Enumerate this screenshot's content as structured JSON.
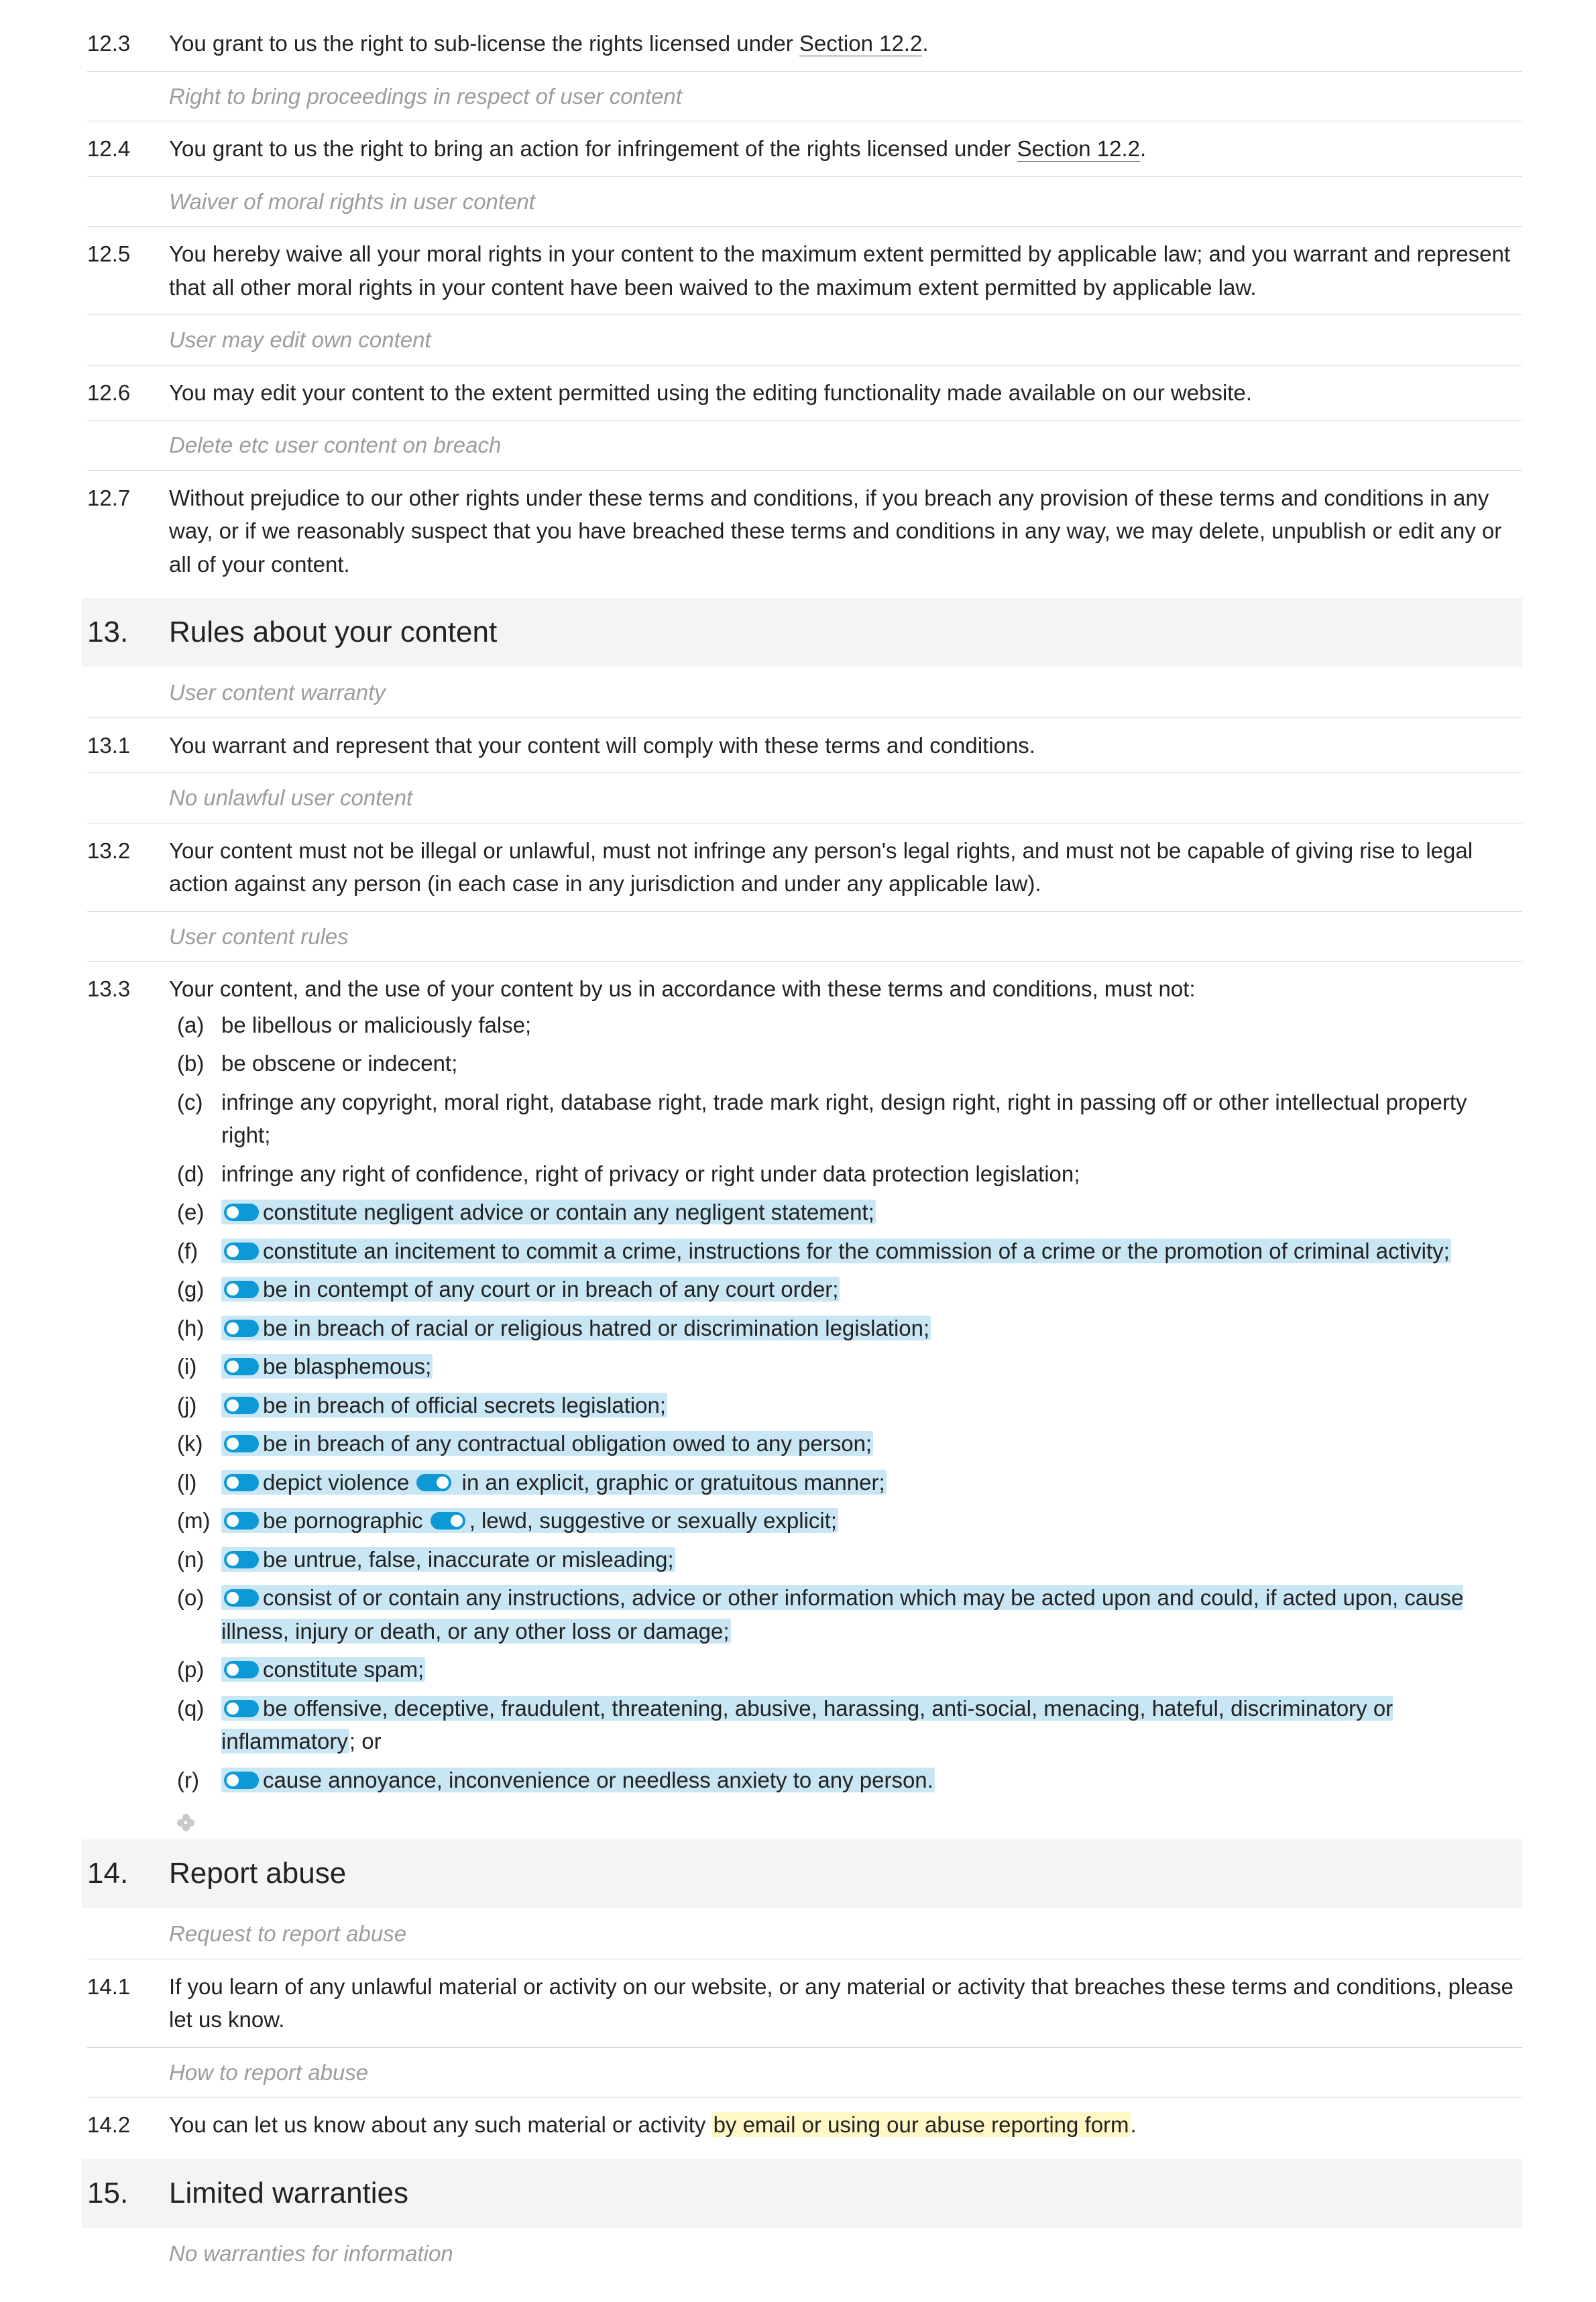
{
  "clauses": {
    "c12_3": {
      "num": "12.3",
      "text_a": "You grant to us the right to sub-license the rights licensed under ",
      "link": "Section 12.2",
      "text_b": "."
    },
    "note_12_3": "Right to bring proceedings in respect of user content",
    "c12_4": {
      "num": "12.4",
      "text_a": "You grant to us the right to bring an action for infringement of the rights licensed under ",
      "link": "Section 12.2",
      "text_b": "."
    },
    "note_12_4": "Waiver of moral rights in user content",
    "c12_5": {
      "num": "12.5",
      "text": "You hereby waive all your moral rights in your content to the maximum extent permitted by applicable law; and you warrant and represent that all other moral rights in your content have been waived to the maximum extent permitted by applicable law."
    },
    "note_12_5": "User may edit own content",
    "c12_6": {
      "num": "12.6",
      "text": "You may edit your content to the extent permitted using the editing functionality made available on our website."
    },
    "note_12_6": "Delete etc user content on breach",
    "c12_7": {
      "num": "12.7",
      "text": "Without prejudice to our other rights under these terms and conditions, if you breach any provision of these terms and conditions in any way, or if we reasonably suspect that you have breached these terms and conditions in any way, we may delete, unpublish or edit any or all of your content."
    }
  },
  "section13": {
    "num": "13.",
    "title": "Rules about your content"
  },
  "s13": {
    "note1": "User content warranty",
    "c13_1": {
      "num": "13.1",
      "text": "You warrant and represent that your content will comply with these terms and conditions."
    },
    "note2": "No unlawful user content",
    "c13_2": {
      "num": "13.2",
      "text": "Your content must not be illegal or unlawful, must not infringe any person's legal rights, and must not be capable of giving rise to legal action against any person (in each case in any jurisdiction and under any applicable law)."
    },
    "note3": "User content rules",
    "c13_3": {
      "num": "13.3",
      "intro": "Your content, and the use of your content by us in accordance with these terms and conditions, must not:",
      "items": {
        "a": {
          "mark": "(a)",
          "text": "be libellous or maliciously false;"
        },
        "b": {
          "mark": "(b)",
          "text": "be obscene or indecent;"
        },
        "c": {
          "mark": "(c)",
          "text": "infringe any copyright, moral right, database right, trade mark right, design right, right in passing off or other intellectual property right;"
        },
        "d": {
          "mark": "(d)",
          "text": "infringe any right of confidence, right of privacy or right under data protection legislation;"
        },
        "e": {
          "mark": "(e)",
          "text": "constitute negligent advice or contain any negligent statement;"
        },
        "f": {
          "mark": "(f)",
          "text": "constitute an incitement to commit a crime, instructions for the commission of a crime or the promotion of criminal activity;"
        },
        "g": {
          "mark": "(g)",
          "text": "be in contempt of any court or in breach of any court order;"
        },
        "h": {
          "mark": "(h)",
          "text": "be in breach of racial or religious hatred or discrimination legislation;"
        },
        "i": {
          "mark": "(i)",
          "text": "be blasphemous;"
        },
        "j": {
          "mark": "(j)",
          "text": "be in breach of official secrets legislation;"
        },
        "k": {
          "mark": "(k)",
          "text": "be in breach of any contractual obligation owed to any person;"
        },
        "l": {
          "mark": "(l)",
          "t1": "depict violence ",
          "t2": " in an explicit, graphic or gratuitous manner;"
        },
        "m": {
          "mark": "(m)",
          "t1": "be pornographic ",
          "t2": ", lewd, suggestive or sexually explicit;"
        },
        "n": {
          "mark": "(n)",
          "text": "be untrue, false, inaccurate or misleading;"
        },
        "o": {
          "mark": "(o)",
          "text": "consist of or contain any instructions, advice or other information which may be acted upon and could, if acted upon, cause illness, injury or death, or any other loss or damage;"
        },
        "p": {
          "mark": "(p)",
          "text": "constitute spam;"
        },
        "q": {
          "mark": "(q)",
          "t1": "be offensive, deceptive, fraudulent, threatening, abusive, harassing, anti-social, menacing, hateful, discriminatory or inflammatory",
          "t2": "; or"
        },
        "r": {
          "mark": "(r)",
          "text": "cause annoyance, inconvenience or needless anxiety to any person."
        }
      }
    }
  },
  "section14": {
    "num": "14.",
    "title": "Report abuse"
  },
  "s14": {
    "note1": "Request to report abuse",
    "c14_1": {
      "num": "14.1",
      "text": "If you learn of any unlawful material or activity on our website, or any material or activity that breaches these terms and conditions, please let us know."
    },
    "note2": "How to report abuse",
    "c14_2": {
      "num": "14.2",
      "t1": "You can let us know about any such material or activity ",
      "hl": "by email or using our abuse reporting form",
      "t2": "."
    }
  },
  "section15": {
    "num": "15.",
    "title": "Limited warranties"
  },
  "s15": {
    "note1": "No warranties for information"
  }
}
